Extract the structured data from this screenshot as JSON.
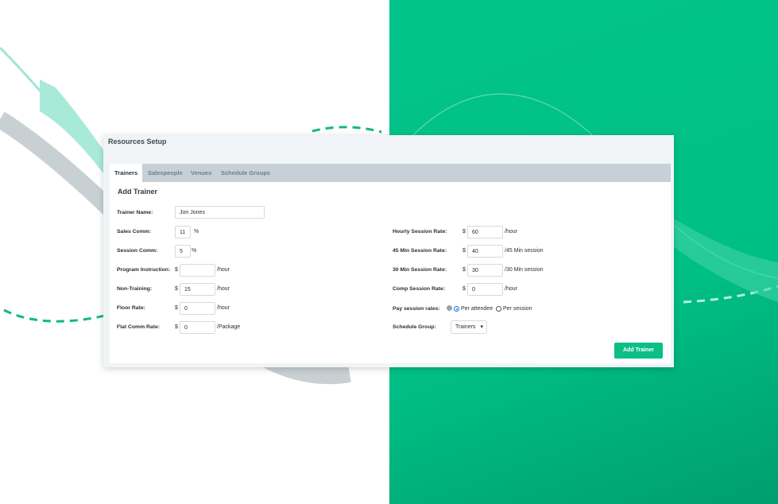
{
  "panel": {
    "title": "Resources Setup",
    "tabs": [
      {
        "label": "Trainers",
        "active": true
      },
      {
        "label": "Salespeople",
        "active": false
      },
      {
        "label": "Venues",
        "active": false
      },
      {
        "label": "Schedule Groups",
        "active": false
      }
    ],
    "section_title": "Add Trainer"
  },
  "form": {
    "trainer_name": {
      "label": "Trainer Name:",
      "value": "Jon Jones"
    },
    "sales_comm": {
      "label": "Sales Comm:",
      "value": "11",
      "unit": "%"
    },
    "session_comm": {
      "label": "Session Comm:",
      "value": "5",
      "unit": "%"
    },
    "program_instruction": {
      "label": "Program Instruction:",
      "currency": "$",
      "value": "",
      "unit": "/hour"
    },
    "non_training": {
      "label": "Non-Training:",
      "currency": "$",
      "value": "15",
      "unit": "/hour"
    },
    "floor_rate": {
      "label": "Floor Rate:",
      "currency": "$",
      "value": "0",
      "unit": "/hour"
    },
    "flat_comm_rate": {
      "label": "Flat Comm Rate:",
      "currency": "$",
      "value": "0",
      "unit": "/Package"
    },
    "hourly_session_rate": {
      "label": "Hourly Session Rate:",
      "currency": "$",
      "value": "60",
      "unit": "/hour"
    },
    "min45_session_rate": {
      "label": "45 Min Session Rate:",
      "currency": "$",
      "value": "40",
      "unit": "/45 Min session"
    },
    "min30_session_rate": {
      "label": "30 Min Session Rate:",
      "currency": "$",
      "value": "30",
      "unit": "/30 Min session"
    },
    "comp_session_rate": {
      "label": "Comp Session Rate:",
      "currency": "$",
      "value": "0",
      "unit": "/hour"
    },
    "pay_session_rates": {
      "label": "Pay session rates:",
      "option1": "Per attendee",
      "option2": "Per session",
      "selected": "Per attendee"
    },
    "schedule_group": {
      "label": "Schedule Group:",
      "value": "Trainers"
    }
  },
  "actions": {
    "add_trainer": "Add Trainer"
  },
  "colors": {
    "accent": "#0cbf86",
    "background_green": "#00bf86"
  }
}
